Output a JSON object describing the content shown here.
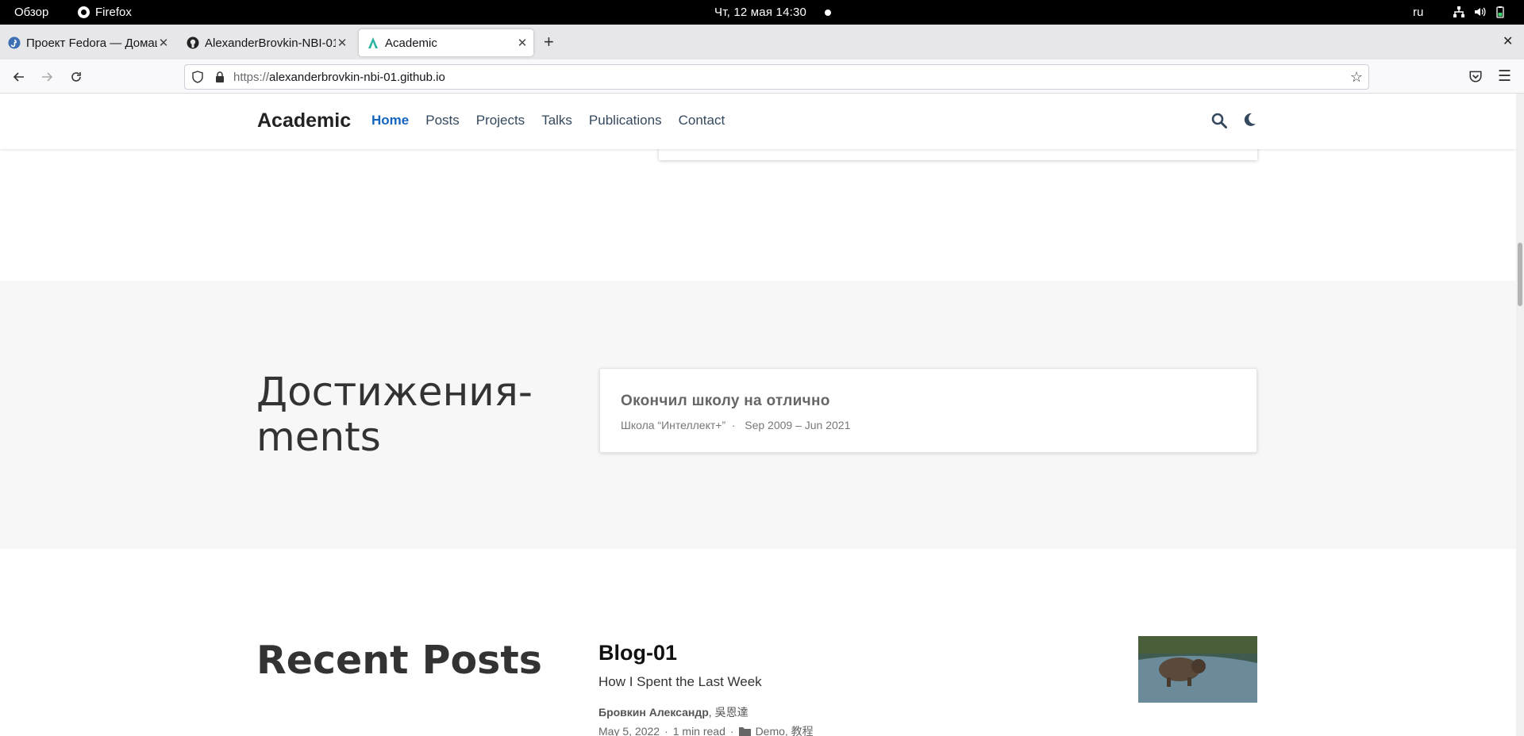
{
  "system": {
    "overview": "Обзор",
    "app": "Firefox",
    "clock": "Чт, 12 мая  14:30",
    "lang": "ru"
  },
  "tabs": [
    {
      "label": "Проект Fedora — Домаш",
      "favicon": "fedora-icon"
    },
    {
      "label": "AlexanderBrovkin-NBI-01",
      "favicon": "github-icon"
    },
    {
      "label": "Academic",
      "favicon": "academic-icon"
    }
  ],
  "toolbar": {
    "url_scheme": "https://",
    "url_host": "alexanderbrovkin-nbi-01.github.io"
  },
  "site": {
    "brand": "Academic",
    "nav": [
      "Home",
      "Posts",
      "Projects",
      "Talks",
      "Publications",
      "Contact"
    ],
    "active_nav": "Home"
  },
  "achievements": {
    "title_line1": "Достижения-",
    "title_line2": "ments",
    "card_title": "Окончил школу на отлично",
    "card_org": "Школа “Интеллект+”",
    "card_sep": "·",
    "card_dates": "Sep 2009 – Jun 2021"
  },
  "recent_posts": {
    "title": "Recent Posts",
    "post": {
      "title": "Blog-01",
      "summary": "How I Spent the Last Week",
      "author_main": "Бровкин Александр",
      "author_other": ", 吳恩達",
      "date": "May 5, 2022",
      "sep": "·",
      "read_time": "1 min read",
      "categories": "Demo, 教程"
    }
  },
  "colors": {
    "accent": "#1565c0",
    "section_bg": "#f7f7f7",
    "topbar": "#000000"
  }
}
